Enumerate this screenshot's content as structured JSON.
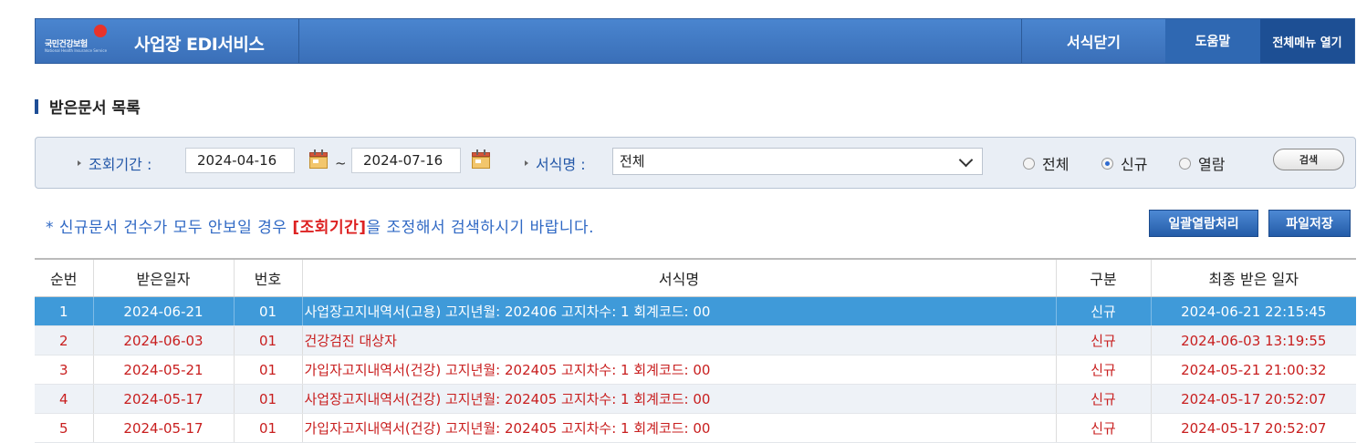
{
  "header": {
    "logo_text": "국민건강보험",
    "logo_sub": "National Health Insurance Service",
    "app_title": "사업장 EDI서비스",
    "close_label": "서식닫기",
    "help_label": "도움말",
    "menu_label": "전체메뉴 열기"
  },
  "section_title": "받은문서 목록",
  "search": {
    "period_label": "조회기간 :",
    "date_from": "2024-04-16",
    "tilde": "~",
    "date_to": "2024-07-16",
    "form_label": "서식명 :",
    "form_selected": "전체",
    "radio_all": "전체",
    "radio_new": "신규",
    "radio_read": "열람",
    "radio_selected": "신규",
    "search_button": "검색"
  },
  "notice": {
    "prefix": "* 신규문서 건수가 모두 안보일 경우 ",
    "emphasis": "[조회기간]",
    "suffix": "을 조정해서 검색하시기 바랍니다."
  },
  "actions": {
    "bulk_open": "일괄열람처리",
    "file_save": "파일저장"
  },
  "table": {
    "columns": [
      "순번",
      "받은일자",
      "번호",
      "서식명",
      "구분",
      "최종 받은 일자"
    ],
    "rows": [
      [
        "1",
        "2024-06-21",
        "01",
        "사업장고지내역서(고용) 고지년월: 202406 고지차수: 1 회계코드: 00",
        "신규",
        "2024-06-21 22:15:45"
      ],
      [
        "2",
        "2024-06-03",
        "01",
        "건강검진 대상자",
        "신규",
        "2024-06-03 13:19:55"
      ],
      [
        "3",
        "2024-05-21",
        "01",
        "가입자고지내역서(건강) 고지년월: 202405 고지차수: 1 회계코드: 00",
        "신규",
        "2024-05-21 21:00:32"
      ],
      [
        "4",
        "2024-05-17",
        "01",
        "사업장고지내역서(건강) 고지년월: 202405 고지차수: 1 회계코드: 00",
        "신규",
        "2024-05-17 20:52:07"
      ],
      [
        "5",
        "2024-05-17",
        "01",
        "가입자고지내역서(건강) 고지년월: 202405 고지차수: 1 회계코드: 00",
        "신규",
        "2024-05-17 20:52:07"
      ]
    ]
  }
}
